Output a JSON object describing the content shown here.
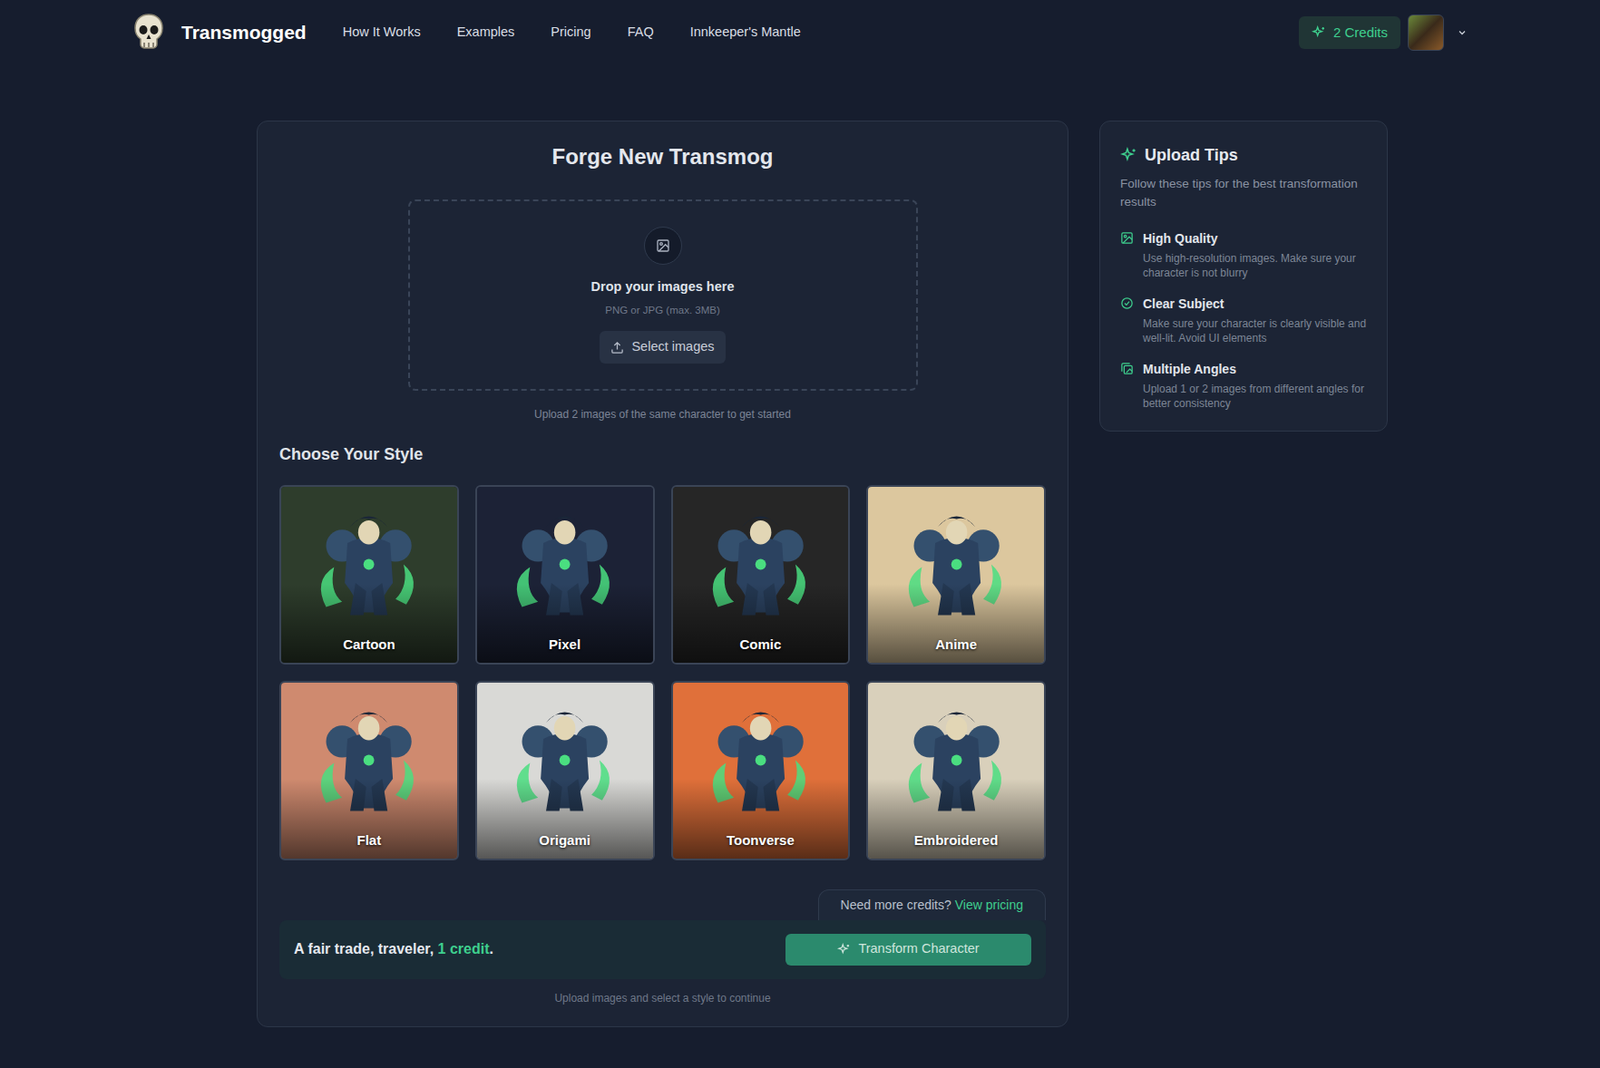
{
  "header": {
    "brand": "Transmogged",
    "nav": [
      {
        "label": "How It Works"
      },
      {
        "label": "Examples"
      },
      {
        "label": "Pricing"
      },
      {
        "label": "FAQ"
      },
      {
        "label": "Innkeeper's Mantle"
      }
    ],
    "credits": "2 Credits"
  },
  "upload": {
    "title": "Forge New Transmog",
    "drop_title": "Drop your images here",
    "formats": "PNG or JPG (max. 3MB)",
    "button": "Select images",
    "hint": "Upload 2 images of the same character to get started"
  },
  "styles": {
    "heading": "Choose Your Style",
    "items": [
      {
        "label": "Cartoon",
        "selected": false,
        "color": "#2e3d2c"
      },
      {
        "label": "Pixel",
        "selected": false,
        "color": "#1c2236"
      },
      {
        "label": "Comic",
        "selected": false,
        "color": "#262626"
      },
      {
        "label": "Anime",
        "selected": false,
        "color": "#dcc79e"
      },
      {
        "label": "Flat",
        "selected": false,
        "color": "#cf8a6f"
      },
      {
        "label": "Origami",
        "selected": false,
        "color": "#d9d9d6"
      },
      {
        "label": "Toonverse",
        "selected": false,
        "color": "#e0703a"
      },
      {
        "label": "Embroidered",
        "selected": false,
        "color": "#d9d0bb"
      }
    ]
  },
  "footer": {
    "more_credits": "Need more credits?",
    "pricing_link": "View pricing",
    "cost_prefix": "A fair trade, traveler, ",
    "cost": "1 credit",
    "cost_suffix": ".",
    "button": {
      "label": "Transform Character",
      "disabled": true
    },
    "hint": "Upload images and select a style to continue"
  },
  "tips": {
    "title": "Upload Tips",
    "subtitle": "Follow these tips for the best transformation results",
    "items": [
      {
        "title": "High Quality",
        "text": "Use high-resolution images. Make sure your character is not blurry"
      },
      {
        "title": "Clear Subject",
        "text": "Make sure your character is clearly visible and well-lit. Avoid UI elements"
      },
      {
        "title": "Multiple Angles",
        "text": "Upload 1 or 2 images from different angles for better consistency"
      }
    ]
  }
}
